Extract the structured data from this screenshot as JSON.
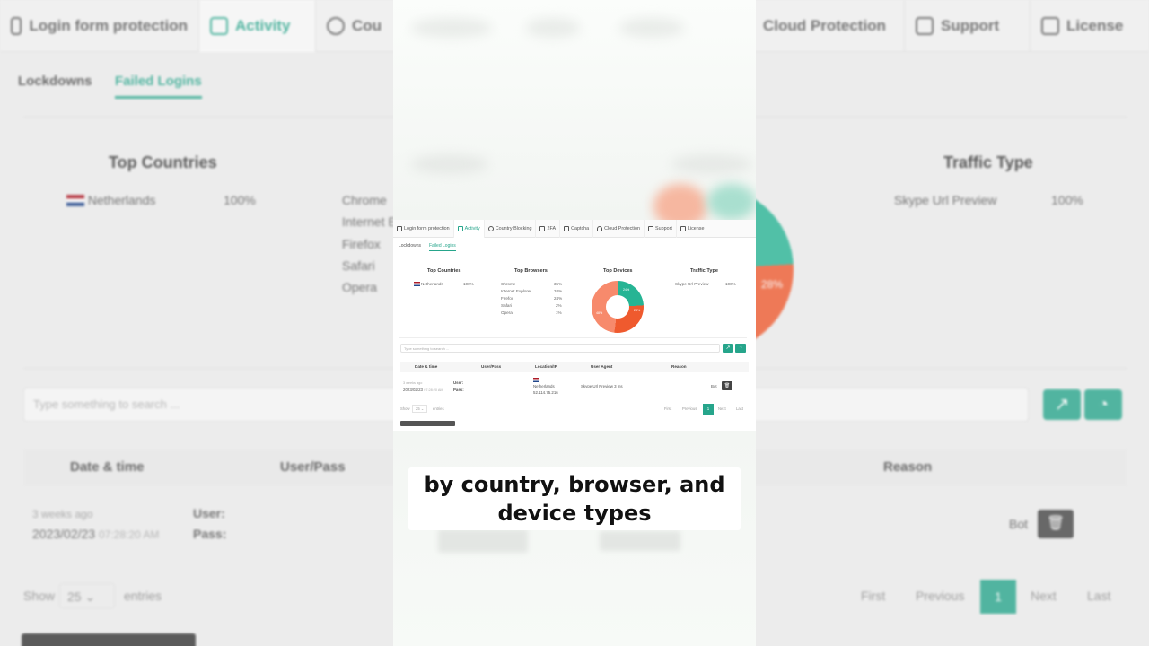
{
  "tabs": [
    {
      "label": "Login form protection",
      "icon": "login-icon"
    },
    {
      "label": "Activity",
      "icon": "document-icon",
      "active": true
    },
    {
      "label": "Country Blocking",
      "icon": "globe-icon"
    },
    {
      "label": "2FA",
      "icon": "two-factor-icon"
    },
    {
      "label": "Captcha",
      "icon": "captcha-icon"
    },
    {
      "label": "Cloud Protection",
      "icon": "cloud-icon"
    },
    {
      "label": "Support",
      "icon": "support-icon"
    },
    {
      "label": "License",
      "icon": "key-icon"
    }
  ],
  "bg_tabs": {
    "login": "Login form protection",
    "activity": "Activity",
    "country_partial": "Cou",
    "cloud": "Cloud Protection",
    "support": "Support",
    "license": "License"
  },
  "subtabs": {
    "lockdowns": "Lockdowns",
    "failed_logins": "Failed Logins"
  },
  "stats": {
    "top_countries": {
      "title": "Top Countries",
      "rows": [
        {
          "label": "Netherlands",
          "value": "100%"
        }
      ]
    },
    "top_browsers": {
      "title": "Top Browsers",
      "rows": [
        {
          "label": "Chrome",
          "value": "35%"
        },
        {
          "label": "Internet Explorer",
          "value": "34%"
        },
        {
          "label": "Firefox",
          "value": "24%"
        },
        {
          "label": "Safari",
          "value": "2%"
        },
        {
          "label": "Opera",
          "value": "1%"
        }
      ]
    },
    "top_devices": {
      "title": "Top Devices",
      "donut_labels": [
        "24%",
        "28%",
        "48%"
      ]
    },
    "traffic_type": {
      "title": "Traffic Type",
      "rows": [
        {
          "label": "Skype Url Preview",
          "value": "100%"
        }
      ]
    }
  },
  "bg_stats": {
    "top_countries_title": "Top Countries",
    "traffic_type_title": "Traffic Type",
    "browsers": [
      "Chrome",
      "Internet E",
      "Firefox",
      "Safari",
      "Opera"
    ],
    "pie_label": "28%"
  },
  "search": {
    "placeholder": "Type something to search ..."
  },
  "table": {
    "columns": [
      "Date & time",
      "User/Pass",
      "Location/IP",
      "User Agent",
      "Reason"
    ],
    "row": {
      "relative": "3 weeks ago",
      "date": "2023/02/23",
      "time": "07:28:20 AM",
      "user_label": "User:",
      "pass_label": "Pass:",
      "country": "Netherlands",
      "ip": "52.114.75.216",
      "agent": "Skype Url Preview 3 ms",
      "reason": "Bot"
    }
  },
  "pagination": {
    "show": "Show",
    "entries_value": "25",
    "entries": "entries",
    "first": "First",
    "previous": "Previous",
    "current": "1",
    "next": "Next",
    "last": "Last"
  },
  "caption": {
    "line1": "by country, browser, and",
    "line2": "device types"
  },
  "colors": {
    "accent": "#26a58b",
    "donut_green": "#26b494",
    "donut_red": "#ef5a2e",
    "donut_salmon": "#f78a6c"
  }
}
